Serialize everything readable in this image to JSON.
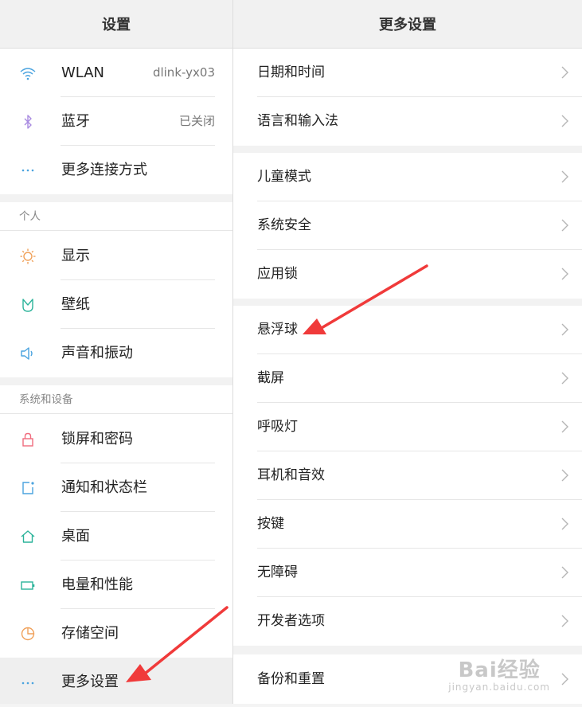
{
  "left_panel": {
    "title": "设置",
    "network_items": [
      {
        "label": "WLAN",
        "value": "dlink-yx03",
        "icon": "wifi-icon"
      },
      {
        "label": "蓝牙",
        "value": "已关闭",
        "icon": "bluetooth-icon"
      },
      {
        "label": "更多连接方式",
        "value": "",
        "icon": "more-dots-icon"
      }
    ],
    "section_personal": "个人",
    "personal_items": [
      {
        "label": "显示",
        "icon": "brightness-icon"
      },
      {
        "label": "壁纸",
        "icon": "wallpaper-icon"
      },
      {
        "label": "声音和振动",
        "icon": "speaker-icon"
      }
    ],
    "section_system": "系统和设备",
    "system_items": [
      {
        "label": "锁屏和密码",
        "icon": "lock-icon"
      },
      {
        "label": "通知和状态栏",
        "icon": "notification-icon"
      },
      {
        "label": "桌面",
        "icon": "home-icon"
      },
      {
        "label": "电量和性能",
        "icon": "battery-icon"
      },
      {
        "label": "存储空间",
        "icon": "storage-icon"
      },
      {
        "label": "更多设置",
        "icon": "more-dots-icon",
        "selected": true
      }
    ]
  },
  "right_panel": {
    "title": "更多设置",
    "group1": [
      "日期和时间",
      "语言和输入法"
    ],
    "group2": [
      "儿童模式",
      "系统安全",
      "应用锁"
    ],
    "group3": [
      "悬浮球",
      "截屏",
      "呼吸灯",
      "耳机和音效",
      "按键",
      "无障碍",
      "开发者选项"
    ],
    "group4": [
      "备份和重置"
    ]
  },
  "watermark": {
    "line1": "Bai经验",
    "line2": "jingyan.baidu.com"
  },
  "colors": {
    "wifi": "#4aa3df",
    "bluetooth": "#a98be0",
    "dots": "#4aa3df",
    "brightness": "#f0a15a",
    "wallpaper": "#2bb39a",
    "speaker": "#4aa3df",
    "lock": "#f06b7d",
    "notification": "#4aa3df",
    "home": "#2bb39a",
    "battery": "#2bb39a",
    "storage": "#f0a15a",
    "arrow": "#f03a3a"
  }
}
